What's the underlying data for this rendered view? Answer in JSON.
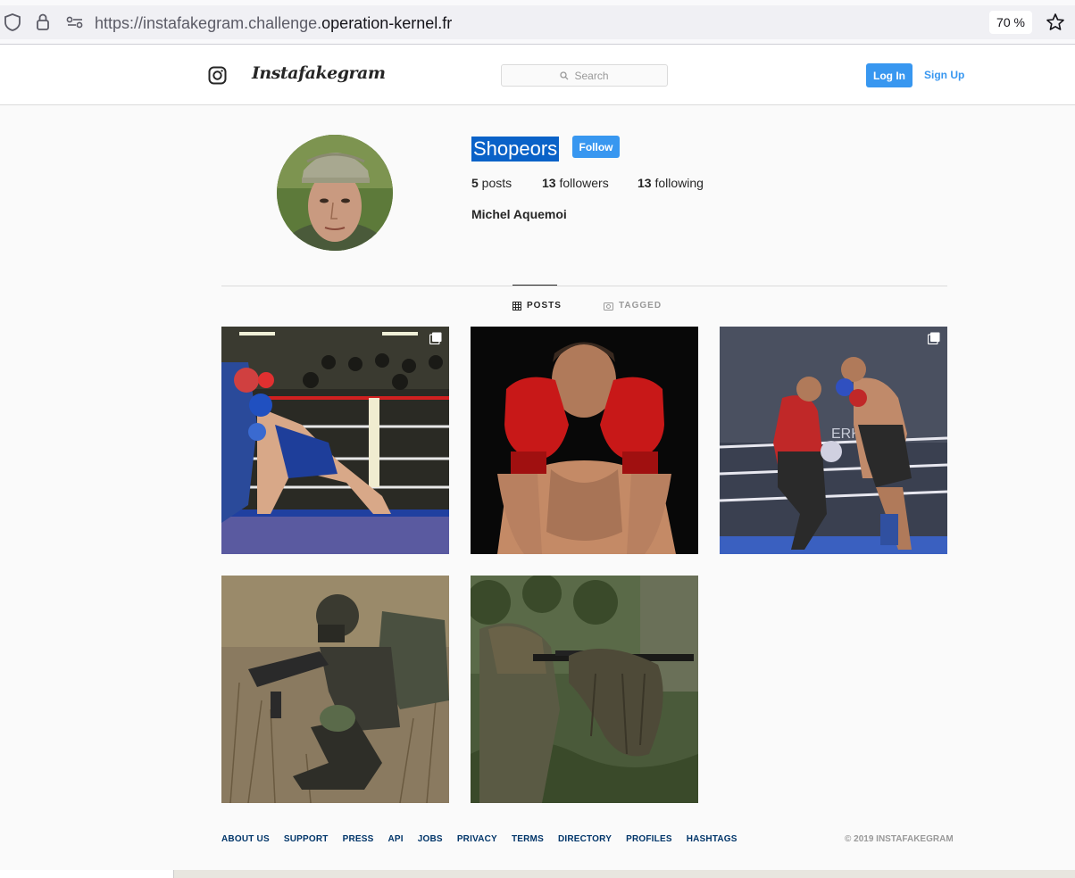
{
  "browser": {
    "url_prefix": "https://instafakegram.challenge.",
    "url_host": "operation-kernel.fr",
    "zoom": "70 %"
  },
  "header": {
    "brand": "Instafakegram",
    "search_placeholder": "Search",
    "login_label": "Log In",
    "signup_label": "Sign Up"
  },
  "profile": {
    "username": "Shopeors",
    "follow_label": "Follow",
    "posts_count": "5",
    "posts_label": " posts",
    "followers_count": "13",
    "followers_label": " followers",
    "following_count": "13",
    "following_label": " following",
    "full_name": "Michel Aquemoi"
  },
  "tabs": {
    "posts": "POSTS",
    "tagged": "TAGGED"
  },
  "posts": [
    {
      "subject": "boxing-match-blue-vs-red",
      "multi": true
    },
    {
      "subject": "boxer-red-gloves-guard",
      "multi": false
    },
    {
      "subject": "kickboxing-match-ring",
      "multi": true
    },
    {
      "subject": "soldier-crouching-rifle",
      "multi": false
    },
    {
      "subject": "sniper-ghillie-suit",
      "multi": false
    }
  ],
  "footer": {
    "links": [
      "ABOUT US",
      "SUPPORT",
      "PRESS",
      "API",
      "JOBS",
      "PRIVACY",
      "TERMS",
      "DIRECTORY",
      "PROFILES",
      "HASHTAGS"
    ],
    "copyright": "© 2019 INSTAFAKEGRAM"
  },
  "colors": {
    "accent": "#3897f0",
    "selection": "#0a62c8",
    "footer_link": "#003569"
  }
}
